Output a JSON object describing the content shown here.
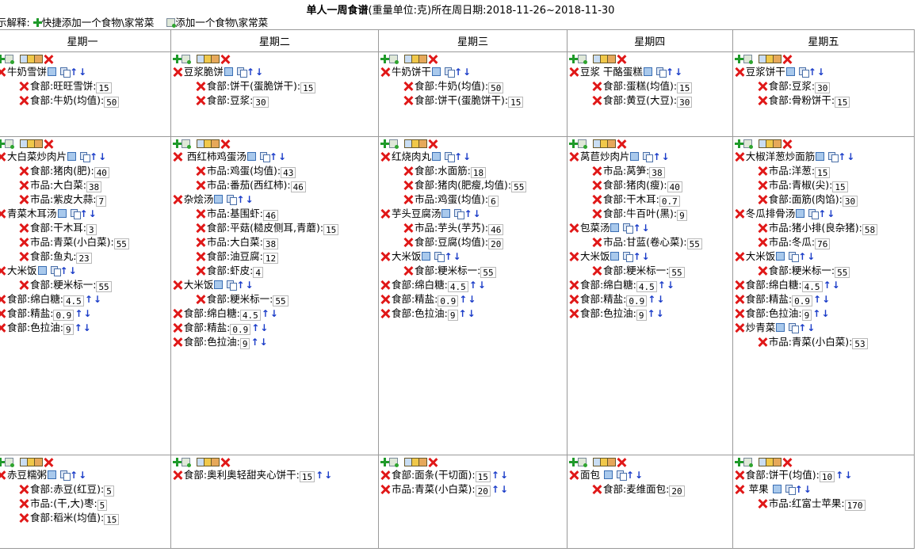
{
  "header": {
    "title": "单人一周食谱",
    "subtitle": "(重量单位:克)所在周日期:2018-11-26~2018-11-30"
  },
  "legend": {
    "prefix": "示解释:",
    "quick_add": "快捷添加一个食物\\家常菜",
    "add": "添加一个食物\\家常菜"
  },
  "days": [
    "星期一",
    "星期二",
    "星期三",
    "星期四",
    "星期五"
  ],
  "rows": [
    [
      {
        "dishes": [
          {
            "name": "牛奶雪饼",
            "ings": [
              {
                "t": "食部:旺旺雪饼:",
                "v": "15"
              },
              {
                "t": "食部:牛奶(均值):",
                "v": "50"
              }
            ]
          }
        ],
        "items": []
      },
      {
        "dishes": [
          {
            "name": "豆浆脆饼",
            "ings": [
              {
                "t": "食部:饼干(蛋脆饼干):",
                "v": "15"
              },
              {
                "t": "食部:豆浆:",
                "v": "30"
              }
            ]
          }
        ],
        "items": []
      },
      {
        "dishes": [
          {
            "name": "牛奶饼干",
            "ings": [
              {
                "t": "食部:牛奶(均值):",
                "v": "50"
              },
              {
                "t": "食部:饼干(蛋脆饼干):",
                "v": "15"
              }
            ]
          }
        ],
        "items": []
      },
      {
        "dishes": [
          {
            "name": "豆浆  干酪蛋糕",
            "ings": [
              {
                "t": "食部:蛋糕(均值):",
                "v": "15"
              },
              {
                "t": "食部:黄豆(大豆):",
                "v": "30"
              }
            ]
          }
        ],
        "items": []
      },
      {
        "dishes": [
          {
            "name": "豆浆饼干",
            "ings": [
              {
                "t": "食部:豆浆:",
                "v": "30"
              },
              {
                "t": "食部:骨粉饼干:",
                "v": "15"
              }
            ]
          }
        ],
        "items": []
      }
    ],
    [
      {
        "dishes": [
          {
            "name": "大白菜炒肉片",
            "ings": [
              {
                "t": "食部:猪肉(肥):",
                "v": "40"
              },
              {
                "t": "市品:大白菜:",
                "v": "38"
              },
              {
                "t": "市品:紫皮大蒜:",
                "v": "7"
              }
            ]
          },
          {
            "name": "青菜木耳汤",
            "ings": [
              {
                "t": "食部:干木耳:",
                "v": "3"
              },
              {
                "t": "市品:青菜(小白菜):",
                "v": "55"
              },
              {
                "t": "食部:鱼丸:",
                "v": "23"
              }
            ]
          },
          {
            "name": "大米饭",
            "ings": [
              {
                "t": "食部:粳米标一:",
                "v": "55"
              }
            ]
          }
        ],
        "items": [
          {
            "t": "食部:绵白糖:",
            "v": "4.5"
          },
          {
            "t": "食部:精盐:",
            "v": "0.9"
          },
          {
            "t": "食部:色拉油:",
            "v": "9"
          }
        ]
      },
      {
        "dishes": [
          {
            "name": " 西红柿鸡蛋汤",
            "ings": [
              {
                "t": "市品:鸡蛋(均值):",
                "v": "43"
              },
              {
                "t": "市品:番茄(西红柿):",
                "v": "46"
              }
            ]
          },
          {
            "name": "杂烩汤",
            "ings": [
              {
                "t": "市品:基围虾:",
                "v": "46"
              },
              {
                "t": "食部:平菇(糙皮侧耳,青蘑):",
                "v": "15"
              },
              {
                "t": "市品:大白菜:",
                "v": "38"
              },
              {
                "t": "食部:油豆腐:",
                "v": "12"
              },
              {
                "t": "食部:虾皮:",
                "v": "4"
              }
            ]
          },
          {
            "name": "大米饭",
            "ings": [
              {
                "t": "食部:粳米标一:",
                "v": "55"
              }
            ]
          }
        ],
        "items": [
          {
            "t": "食部:绵白糖:",
            "v": "4.5"
          },
          {
            "t": "食部:精盐:",
            "v": "0.9"
          },
          {
            "t": "食部:色拉油:",
            "v": "9"
          }
        ]
      },
      {
        "dishes": [
          {
            "name": "红烧肉丸",
            "ings": [
              {
                "t": "食部:水面筋:",
                "v": "18"
              },
              {
                "t": "食部:猪肉(肥瘦,均值):",
                "v": "55"
              },
              {
                "t": "市品:鸡蛋(均值):",
                "v": "6"
              }
            ]
          },
          {
            "name": "芋头豆腐汤",
            "ings": [
              {
                "t": "市品:芋头(芋艿):",
                "v": "46"
              },
              {
                "t": "食部:豆腐(均值):",
                "v": "20"
              }
            ]
          },
          {
            "name": "大米饭",
            "ings": [
              {
                "t": "食部:粳米标一:",
                "v": "55"
              }
            ]
          }
        ],
        "items": [
          {
            "t": "食部:绵白糖:",
            "v": "4.5"
          },
          {
            "t": "食部:精盐:",
            "v": "0.9"
          },
          {
            "t": "食部:色拉油:",
            "v": "9"
          }
        ]
      },
      {
        "dishes": [
          {
            "name": "莴苣炒肉片",
            "ings": [
              {
                "t": "市品:莴笋:",
                "v": "38"
              },
              {
                "t": "食部:猪肉(瘦):",
                "v": "40"
              },
              {
                "t": "食部:干木耳:",
                "v": "0.7"
              },
              {
                "t": "食部:牛百叶(黑):",
                "v": "9"
              }
            ]
          },
          {
            "name": "包菜汤",
            "ings": [
              {
                "t": "市品:甘蓝(卷心菜):",
                "v": "55"
              }
            ]
          },
          {
            "name": "大米饭",
            "ings": [
              {
                "t": "食部:粳米标一:",
                "v": "55"
              }
            ]
          }
        ],
        "items": [
          {
            "t": "食部:绵白糖:",
            "v": "4.5"
          },
          {
            "t": "食部:精盐:",
            "v": "0.9"
          },
          {
            "t": "食部:色拉油:",
            "v": "9"
          }
        ]
      },
      {
        "dishes": [
          {
            "name": "大椒洋葱炒面筋",
            "ings": [
              {
                "t": "市品:洋葱:",
                "v": "15"
              },
              {
                "t": "市品:青椒(尖):",
                "v": "15"
              },
              {
                "t": "食部:面筋(肉馅):",
                "v": "30"
              }
            ]
          },
          {
            "name": "冬瓜排骨汤",
            "ings": [
              {
                "t": "市品:猪小排(良杂猪):",
                "v": "58"
              },
              {
                "t": "市品:冬瓜:",
                "v": "76"
              }
            ]
          },
          {
            "name": "大米饭",
            "ings": [
              {
                "t": "食部:粳米标一:",
                "v": "55"
              }
            ]
          }
        ],
        "items": [
          {
            "t": "食部:绵白糖:",
            "v": "4.5"
          },
          {
            "t": "食部:精盐:",
            "v": "0.9"
          },
          {
            "t": "食部:色拉油:",
            "v": "9"
          }
        ],
        "tail": [
          {
            "name": "炒青菜",
            "ings": [
              {
                "t": "市品:青菜(小白菜):",
                "v": "53"
              }
            ]
          }
        ]
      }
    ],
    [
      {
        "dishes": [
          {
            "name": "赤豆糯粥",
            "ings": [
              {
                "t": "食部:赤豆(红豆):",
                "v": "5"
              },
              {
                "t": "市品:(干,大)枣:",
                "v": "5"
              },
              {
                "t": "食部:稻米(均值):",
                "v": "15"
              }
            ]
          }
        ],
        "items": []
      },
      {
        "dishes": [],
        "items": [
          {
            "t": "食部:奥利奥轻甜夹心饼干:",
            "v": "15"
          }
        ]
      },
      {
        "dishes": [],
        "items": [
          {
            "t": "食部:面条(干切面):",
            "v": "15"
          },
          {
            "t": "市品:青菜(小白菜):",
            "v": "20"
          }
        ]
      },
      {
        "dishes": [
          {
            "name": "面包 ",
            "ings": [
              {
                "t": "食部:麦维面包:",
                "v": "20"
              }
            ]
          }
        ],
        "items": []
      },
      {
        "dishes": [],
        "items": [
          {
            "t": "食部:饼干(均值):",
            "v": "10"
          }
        ],
        "tail": [
          {
            "name": " 苹果 ",
            "ings": [
              {
                "t": "市品:红富士苹果:",
                "v": "170"
              }
            ]
          }
        ]
      }
    ]
  ]
}
